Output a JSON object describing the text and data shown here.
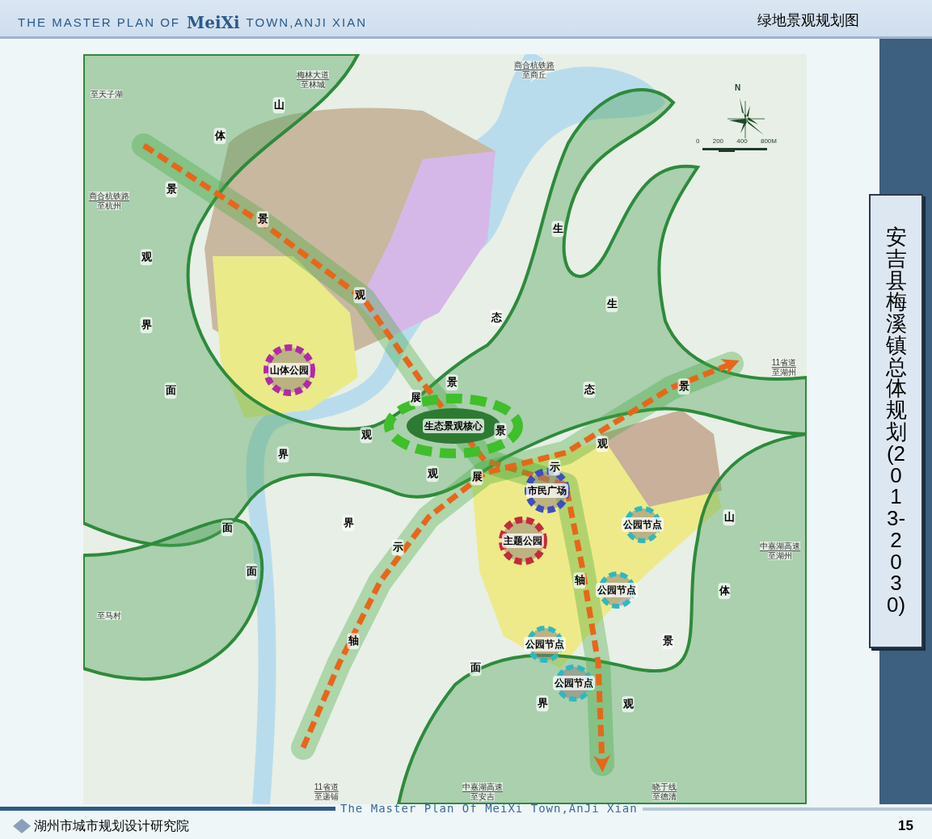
{
  "header": {
    "prefix": "THE MASTER PLAN OF",
    "logo": "MeiXi",
    "suffix": "TOWN,ANJI XIAN",
    "page_title": "绿地景观规划图"
  },
  "map": {
    "compass_label": "N",
    "scale_labels": [
      "0",
      "200",
      "400",
      "800M"
    ],
    "axis_labels": [
      "山",
      "体",
      "景",
      "观",
      "界",
      "面",
      "景",
      "观",
      "展",
      "示",
      "轴",
      "景",
      "观",
      "展",
      "示",
      "轴",
      "生",
      "生",
      "态",
      "态",
      "景",
      "景",
      "观",
      "观",
      "界",
      "界",
      "面",
      "面",
      "山",
      "体",
      "景",
      "观",
      "界",
      "面"
    ],
    "nodes": [
      {
        "label": "山体公园",
        "kind": "park",
        "color": "#b02aa8"
      },
      {
        "label": "生态景观核心",
        "kind": "core",
        "color": "#3fbf2a"
      },
      {
        "label": "市民广场",
        "kind": "park",
        "color": "#3b4fc0"
      },
      {
        "label": "主题公园",
        "kind": "park",
        "color": "#c42a3a"
      },
      {
        "label": "公园节点",
        "kind": "node",
        "color": "#2fb8c0"
      },
      {
        "label": "公园节点",
        "kind": "node",
        "color": "#2fb8c0"
      },
      {
        "label": "公园节点",
        "kind": "node",
        "color": "#2fb8c0"
      },
      {
        "label": "公园节点",
        "kind": "node",
        "color": "#2fb8c0"
      }
    ],
    "road_labels": [
      {
        "name": "梅林大道",
        "destination": "至林城"
      },
      {
        "name": "商合杭铁路",
        "destination": "至商丘"
      },
      {
        "destination": "至天子湖"
      },
      {
        "name": "商合杭铁路",
        "destination": "至杭州"
      },
      {
        "name": "11省道",
        "destination": "至湖州"
      },
      {
        "name": "中嘉湖高速",
        "destination": "至湖州"
      },
      {
        "destination": "至马村"
      },
      {
        "name": "11省道",
        "destination": "至递铺"
      },
      {
        "name": "中嘉湖高速",
        "destination": "至安吉"
      },
      {
        "name": "晓于线",
        "destination": "至德清"
      }
    ]
  },
  "sidebar": {
    "title": "安吉县梅溪镇总体规划(2013-2030)"
  },
  "footer": {
    "banner": "The Master Plan Of MeiXi Town,AnJi Xian",
    "institute": "湖州市城市规划设计研究院",
    "page_number": "15"
  }
}
